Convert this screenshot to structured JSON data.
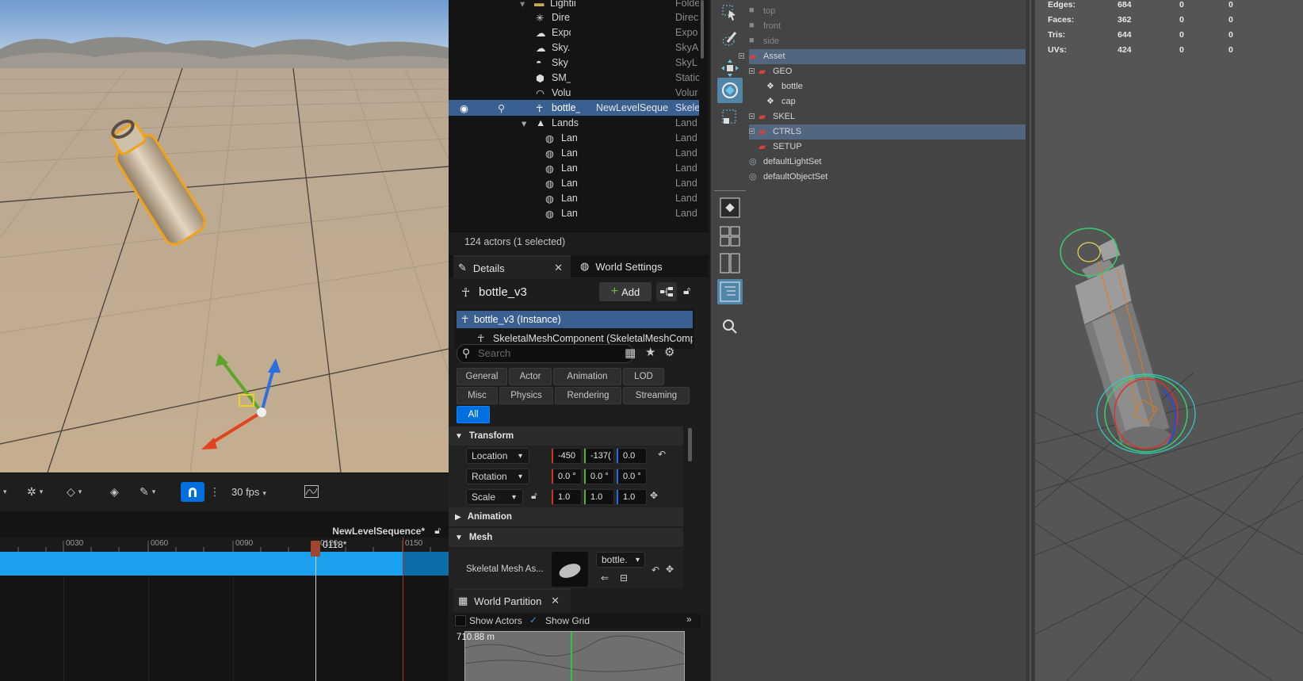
{
  "sequencer": {
    "fps": "30 fps",
    "sequence_name": "NewLevelSequence*",
    "ticks": [
      "0030",
      "0060",
      "0090",
      "0120",
      "0150"
    ],
    "playhead_frame": "0118*"
  },
  "outliner": {
    "rows": [
      {
        "name": "Lightir",
        "type": "Folde"
      },
      {
        "name": "Dire",
        "type": "Direc"
      },
      {
        "name": "Expo",
        "type": "Expo"
      },
      {
        "name": "Sky.",
        "type": "SkyA"
      },
      {
        "name": "Sky",
        "type": "SkyL"
      },
      {
        "name": "SM_",
        "type": "Static"
      },
      {
        "name": "Volu",
        "type": "Volur"
      },
      {
        "name": "bottle_",
        "sequence": "NewLevelSeque",
        "type": "Skele"
      },
      {
        "name": "Lands",
        "type": "Land"
      },
      {
        "name": "Lan",
        "type": "Land"
      },
      {
        "name": "Lan",
        "type": "Land"
      },
      {
        "name": "Lan",
        "type": "Land"
      },
      {
        "name": "Lan",
        "type": "Land"
      },
      {
        "name": "Lan",
        "type": "Land"
      },
      {
        "name": "Lan",
        "type": "Land"
      }
    ],
    "footer": "124 actors (1 selected)"
  },
  "details": {
    "tab_details": "Details",
    "tab_world_settings": "World Settings",
    "actor_name": "bottle_v3",
    "add_label": "Add",
    "component_instance": "bottle_v3 (Instance)",
    "component_mesh": "SkeletalMeshComponent (SkeletalMeshComp",
    "search_placeholder": "Search",
    "filters": [
      "General",
      "Actor",
      "Animation",
      "LOD",
      "Misc",
      "Physics",
      "Rendering",
      "Streaming",
      "All"
    ],
    "transform_header": "Transform",
    "location_label": "Location",
    "location": [
      "-450",
      "-137(",
      "0.0"
    ],
    "rotation_label": "Rotation",
    "rotation": [
      "0.0 °",
      "0.0 °",
      "0.0 °"
    ],
    "scale_label": "Scale",
    "scale": [
      "1.0",
      "1.0",
      "1.0"
    ],
    "animation_header": "Animation",
    "mesh_header": "Mesh",
    "skeletal_mesh_label": "Skeletal Mesh As...",
    "skeletal_mesh_value": "bottle."
  },
  "world_partition": {
    "title": "World Partition",
    "show_actors": "Show Actors",
    "show_grid": "Show Grid",
    "scale_text": "710.88 m"
  },
  "maya_outliner": {
    "rows": [
      {
        "label": "top"
      },
      {
        "label": "front"
      },
      {
        "label": "side"
      },
      {
        "label": "Asset"
      },
      {
        "label": "GEO"
      },
      {
        "label": "bottle"
      },
      {
        "label": "cap"
      },
      {
        "label": "SKEL"
      },
      {
        "label": "CTRLS"
      },
      {
        "label": "SETUP"
      },
      {
        "label": "defaultLightSet"
      },
      {
        "label": "defaultObjectSet"
      }
    ]
  },
  "maya_viewport": {
    "stats": [
      {
        "label": "Edges:",
        "values": [
          "684",
          "0",
          "0"
        ]
      },
      {
        "label": "Faces:",
        "values": [
          "362",
          "0",
          "0"
        ]
      },
      {
        "label": "Tris:",
        "values": [
          "644",
          "0",
          "0"
        ]
      },
      {
        "label": "UVs:",
        "values": [
          "424",
          "0",
          "0"
        ]
      }
    ]
  }
}
